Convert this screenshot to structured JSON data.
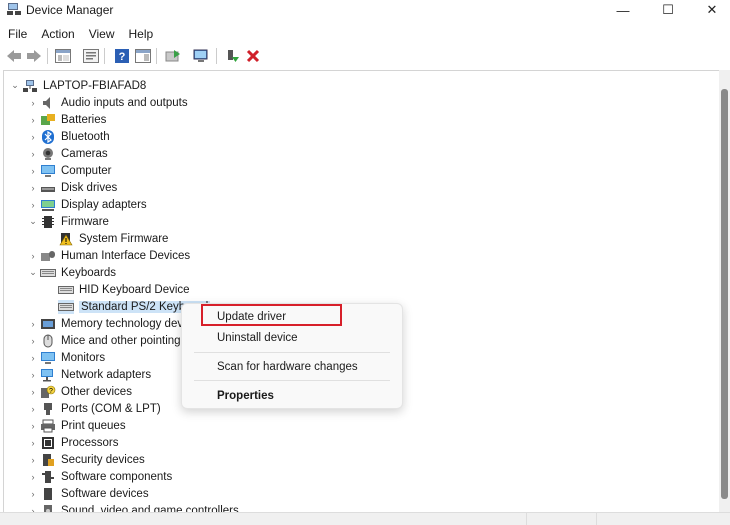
{
  "window": {
    "title": "Device Manager",
    "min_glyph": "—",
    "max_glyph": "☐",
    "close_glyph": "✕"
  },
  "menu": [
    "File",
    "Action",
    "View",
    "Help"
  ],
  "toolbar": {
    "icons": [
      "back-arrow-icon",
      "forward-arrow-icon",
      "show-hide-tree-icon",
      "properties-icon",
      "help-icon",
      "action-pane-icon",
      "update-driver-icon",
      "scan-hardware-icon",
      "enable-device-icon",
      "uninstall-device-icon"
    ]
  },
  "tree": {
    "root": "LAPTOP-FBIAFAD8",
    "items": [
      {
        "label": "Audio inputs and outputs",
        "icon": "speaker-icon",
        "state": "collapsed"
      },
      {
        "label": "Batteries",
        "icon": "battery-icon",
        "state": "collapsed"
      },
      {
        "label": "Bluetooth",
        "icon": "bluetooth-icon",
        "state": "collapsed"
      },
      {
        "label": "Cameras",
        "icon": "camera-icon",
        "state": "collapsed"
      },
      {
        "label": "Computer",
        "icon": "monitor-icon",
        "state": "collapsed"
      },
      {
        "label": "Disk drives",
        "icon": "disk-drive-icon",
        "state": "collapsed"
      },
      {
        "label": "Display adapters",
        "icon": "display-adapter-icon",
        "state": "collapsed"
      },
      {
        "label": "Firmware",
        "icon": "firmware-icon",
        "state": "expanded"
      },
      {
        "label": "System Firmware",
        "icon": "system-firmware-warning-icon",
        "state": "child"
      },
      {
        "label": "Human Interface Devices",
        "icon": "hid-icon",
        "state": "collapsed"
      },
      {
        "label": "Keyboards",
        "icon": "keyboard-icon",
        "state": "expanded"
      },
      {
        "label": "HID Keyboard Device",
        "icon": "keyboard-icon",
        "state": "child"
      },
      {
        "label": "Standard PS/2 Keyboard",
        "icon": "keyboard-icon",
        "state": "child-selected"
      },
      {
        "label": "Memory technology devices",
        "icon": "memory-icon",
        "state": "collapsed"
      },
      {
        "label": "Mice and other pointing devices",
        "icon": "mouse-icon",
        "state": "collapsed"
      },
      {
        "label": "Monitors",
        "icon": "monitor-icon",
        "state": "collapsed"
      },
      {
        "label": "Network adapters",
        "icon": "network-adapter-icon",
        "state": "collapsed"
      },
      {
        "label": "Other devices",
        "icon": "other-devices-icon",
        "state": "collapsed"
      },
      {
        "label": "Ports (COM & LPT)",
        "icon": "port-icon",
        "state": "collapsed"
      },
      {
        "label": "Print queues",
        "icon": "printer-icon",
        "state": "collapsed"
      },
      {
        "label": "Processors",
        "icon": "processor-icon",
        "state": "collapsed"
      },
      {
        "label": "Security devices",
        "icon": "security-device-icon",
        "state": "collapsed"
      },
      {
        "label": "Software components",
        "icon": "software-component-icon",
        "state": "collapsed"
      },
      {
        "label": "Software devices",
        "icon": "software-device-icon",
        "state": "collapsed"
      },
      {
        "label": "Sound, video and game controllers",
        "icon": "sound-controller-icon",
        "state": "collapsed"
      }
    ]
  },
  "context_menu": {
    "items": [
      {
        "label": "Update driver",
        "highlighted": true
      },
      {
        "label": "Uninstall device"
      },
      {
        "label": "Scan for hardware changes"
      },
      {
        "label": "Properties",
        "bold": true
      }
    ],
    "highlight_color": "#d71f2a"
  },
  "colors": {
    "selection": "#cde3f7",
    "highlight_box": "#d71f2a"
  }
}
